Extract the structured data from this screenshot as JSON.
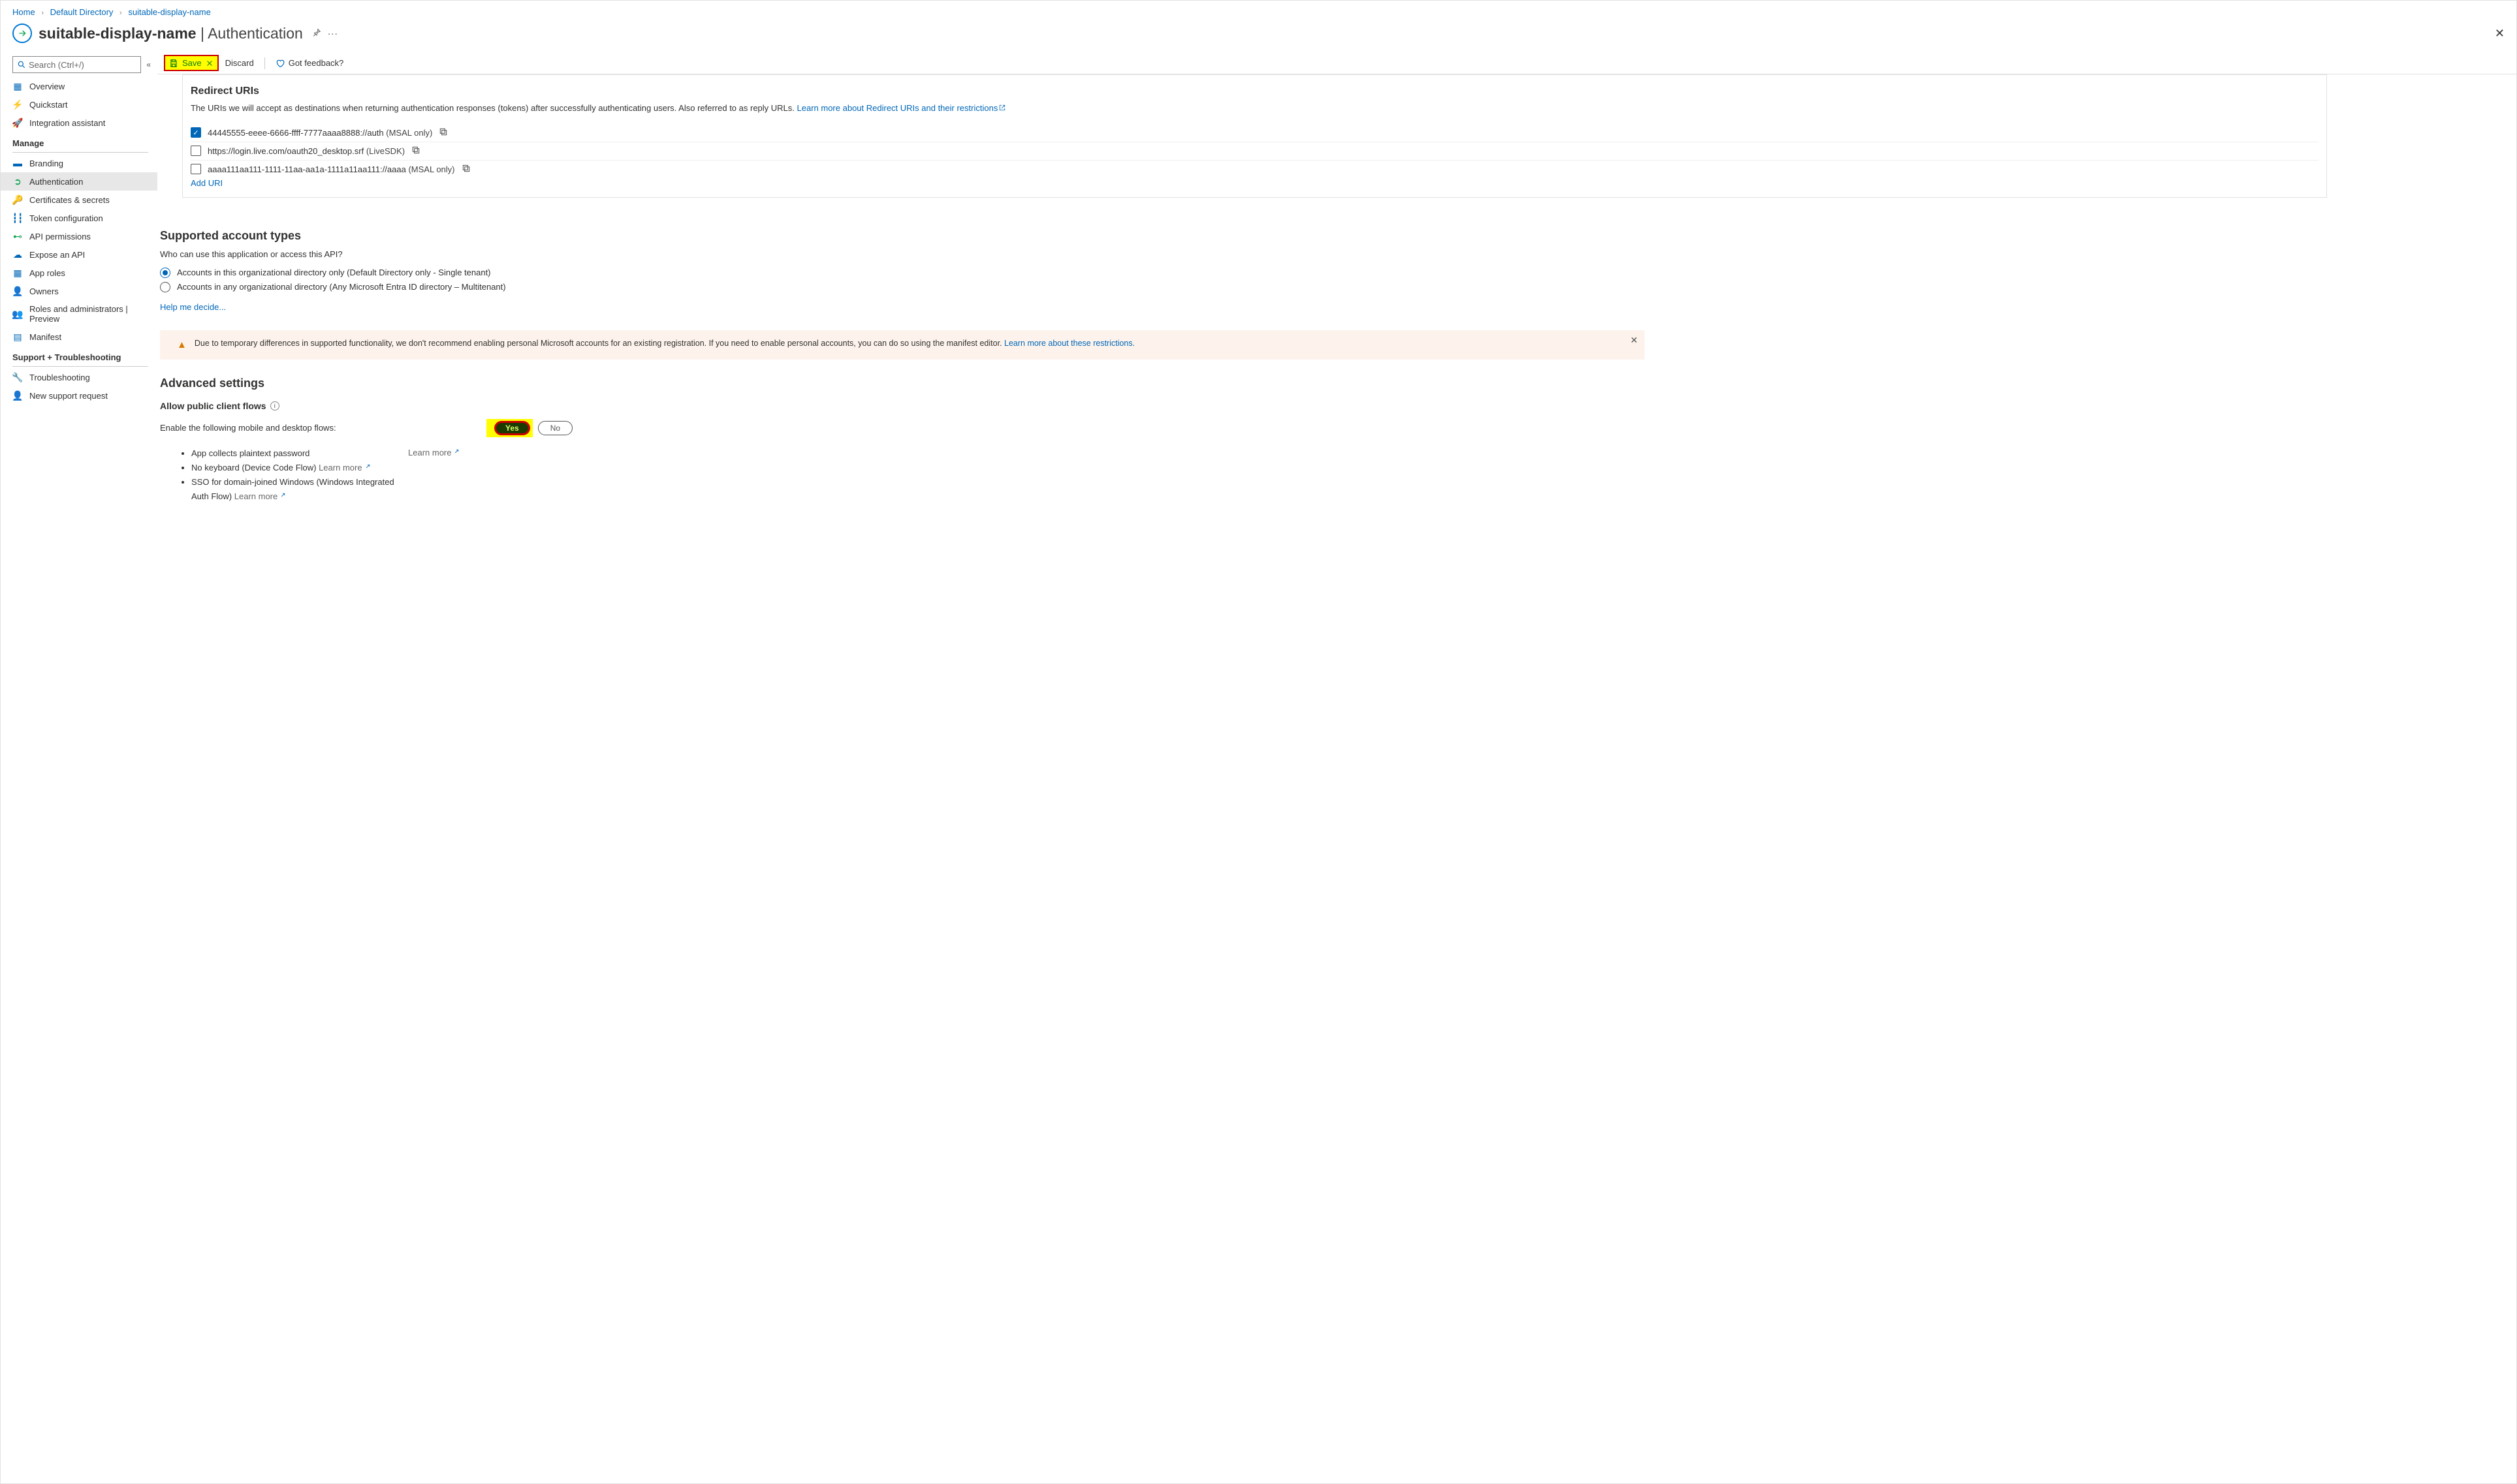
{
  "breadcrumb": {
    "home": "Home",
    "dir": "Default Directory",
    "app": "suitable-display-name"
  },
  "header": {
    "title": "suitable-display-name",
    "suffix": " | Authentication"
  },
  "search": {
    "placeholder": "Search (Ctrl+/)"
  },
  "nav": {
    "top": [
      {
        "label": "Overview"
      },
      {
        "label": "Quickstart"
      },
      {
        "label": "Integration assistant"
      }
    ],
    "manage_title": "Manage",
    "manage": [
      {
        "label": "Branding"
      },
      {
        "label": "Authentication",
        "active": true
      },
      {
        "label": "Certificates & secrets"
      },
      {
        "label": "Token configuration"
      },
      {
        "label": "API permissions"
      },
      {
        "label": "Expose an API"
      },
      {
        "label": "App roles"
      },
      {
        "label": "Owners"
      },
      {
        "label": "Roles and administrators | Preview"
      },
      {
        "label": "Manifest"
      }
    ],
    "support_title": "Support + Troubleshooting",
    "support": [
      {
        "label": "Troubleshooting"
      },
      {
        "label": "New support request"
      }
    ]
  },
  "toolbar": {
    "save": "Save",
    "discard": "Discard",
    "feedback": "Got feedback?"
  },
  "redirect": {
    "title": "Redirect URIs",
    "desc": "The URIs we will accept as destinations when returning authentication responses (tokens) after successfully authenticating users. Also referred to as reply URLs. ",
    "learn": "Learn more about Redirect URIs and their restrictions",
    "uris": [
      {
        "checked": true,
        "text": "44445555-eeee-6666-ffff-7777aaaa8888://auth",
        "tag": "(MSAL only)"
      },
      {
        "checked": false,
        "text": "https://login.live.com/oauth20_desktop.srf",
        "tag": "(LiveSDK)"
      },
      {
        "checked": false,
        "text": "aaaa111aa111-1111-11aa-aa1a-1111a11aa111://aaaa",
        "tag": "(MSAL only)"
      }
    ],
    "add": "Add URI"
  },
  "accounts": {
    "title": "Supported account types",
    "sub": "Who can use this application or access this API?",
    "opt1a": "Accounts in this organizational directory only ",
    "opt1b": "(Default Directory only - Single tenant)",
    "opt2a": "Accounts in any organizational directory ",
    "opt2b": "(Any Microsoft Entra ID directory – Multitenant)",
    "help": "Help me decide..."
  },
  "alert": {
    "text": "Due to temporary differences in supported functionality, we don't recommend enabling personal Microsoft accounts for an existing registration. If you need to enable personal accounts, you can do so using the manifest editor. ",
    "link": "Learn more about these restrictions."
  },
  "advanced": {
    "title": "Advanced settings",
    "allow_title": "Allow public client flows",
    "enable_text": "Enable the following mobile and desktop flows:",
    "yes": "Yes",
    "no": "No",
    "learn_more": "Learn more",
    "items": {
      "i1": "App collects plaintext password",
      "i2": "No keyboard (Device Code Flow) ",
      "i2_link": "Learn more",
      "i3a": "SSO for domain-joined Windows (Windows Integrated Auth Flow) ",
      "i3_link": "Learn more"
    }
  }
}
